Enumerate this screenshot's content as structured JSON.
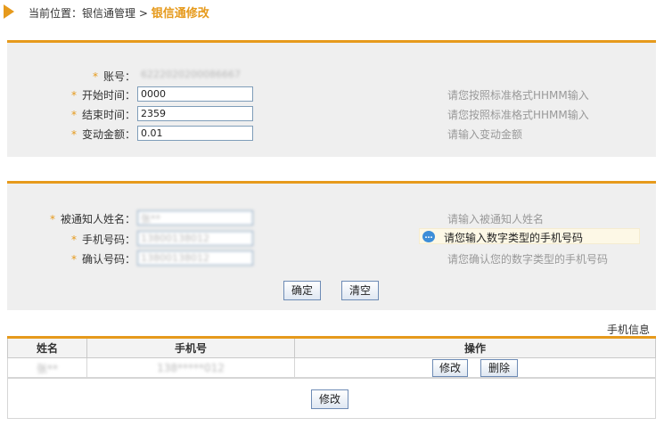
{
  "breadcrumb": {
    "prefix": "当前位置：",
    "section": "银信通管理",
    "separator": ">",
    "current": "银信通修改"
  },
  "account_form": {
    "account": {
      "label": "账号：",
      "value": "6222020200086667"
    },
    "start_time": {
      "label": "开始时间：",
      "value": "0000",
      "hint": "请您按照标准格式HHMM输入"
    },
    "end_time": {
      "label": "结束时间：",
      "value": "2359",
      "hint": "请您按照标准格式HHMM输入"
    },
    "amount": {
      "label": "变动金额：",
      "value": "0.01",
      "hint": "请输入变动金额"
    }
  },
  "notify_form": {
    "name": {
      "label": "被通知人姓名：",
      "value": "张**",
      "hint": "请输入被通知人姓名"
    },
    "mobile": {
      "label": "手机号码：",
      "value": "13800138012",
      "tip": "请您输入数字类型的手机号码"
    },
    "confirm": {
      "label": "确认号码：",
      "value": "13800138012",
      "hint": "请您确认您的数字类型的手机号码"
    },
    "confirm_button": "确定",
    "clear_button": "清空"
  },
  "phone_table": {
    "caption": "手机信息",
    "headers": [
      "姓名",
      "手机号",
      "操作"
    ],
    "rows": [
      {
        "name": "张**",
        "phone": "138*****012",
        "edit": "修改",
        "delete": "删除"
      }
    ],
    "footer_button": "修改"
  },
  "colors": {
    "accent": "#e69a1c",
    "panel_bg": "#efefef",
    "input_border": "#7f9db9",
    "tip_bg": "#fdf8e6"
  },
  "icons": {
    "breadcrumb": "triangle-right-icon",
    "tip": "speech-bubble-icon"
  }
}
